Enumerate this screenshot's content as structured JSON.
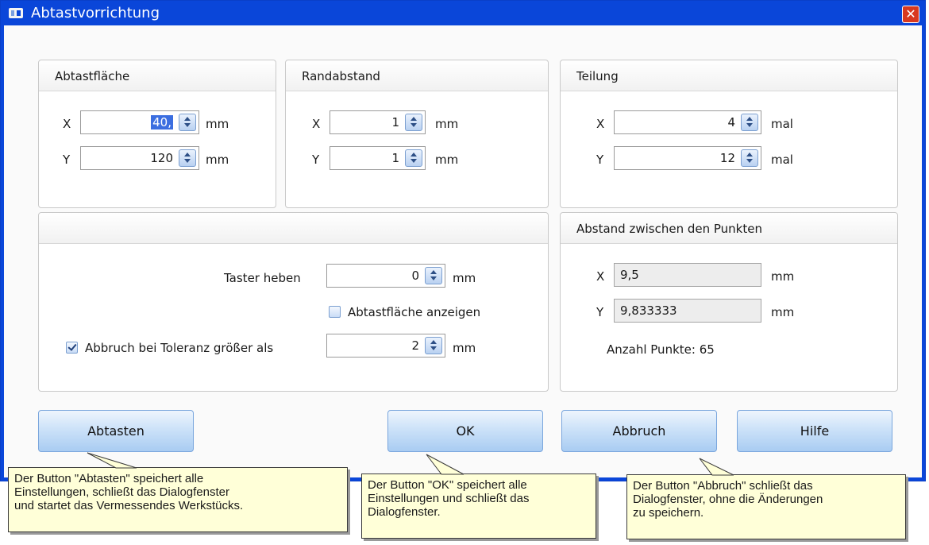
{
  "window": {
    "title": "Abtastvorrichtung",
    "close_glyph": "✕"
  },
  "groups": {
    "abtastflaeche": {
      "title": "Abtastfläche",
      "x_label": "X",
      "x_value": "40,",
      "x_unit": "mm",
      "y_label": "Y",
      "y_value": "120",
      "y_unit": "mm"
    },
    "randabstand": {
      "title": "Randabstand",
      "x_label": "X",
      "x_value": "1",
      "x_unit": "mm",
      "y_label": "Y",
      "y_value": "1",
      "y_unit": "mm"
    },
    "teilung": {
      "title": "Teilung",
      "x_label": "X",
      "x_value": "4",
      "x_unit": "mal",
      "y_label": "Y",
      "y_value": "12",
      "y_unit": "mal"
    },
    "options": {
      "taster_label": "Taster heben",
      "taster_value": "0",
      "taster_unit": "mm",
      "show_area_label": "Abtastfläche anzeigen",
      "show_area_checked": false,
      "abort_label": "Abbruch bei Toleranz größer als",
      "abort_checked": true,
      "abort_value": "2",
      "abort_unit": "mm"
    },
    "abstand": {
      "title": "Abstand zwischen den Punkten",
      "x_label": "X",
      "x_value": "9,5",
      "x_unit": "mm",
      "y_label": "Y",
      "y_value": "9,833333",
      "y_unit": "mm",
      "count_text": "Anzahl Punkte: 65"
    }
  },
  "buttons": {
    "abtasten": "Abtasten",
    "ok": "OK",
    "abbruch": "Abbruch",
    "hilfe": "Hilfe"
  },
  "callouts": {
    "abtasten": [
      "Der Button \"Abtasten\" speichert alle",
      "Einstellungen, schließt das Dialogfenster",
      "und startet das Vermessendes Werkstücks."
    ],
    "ok": [
      "Der Button \"OK\" speichert alle",
      "Einstellungen und schließt das",
      "Dialogfenster."
    ],
    "abbruch": [
      "Der Button \"Abbruch\" schließt das",
      "Dialogfenster, ohne die Änderungen",
      "zu speichern."
    ]
  },
  "colors": {
    "titlebar": "#0a46d9",
    "callout_bg": "#ffffd8",
    "selection": "#3b6ee0"
  },
  "icons": [
    "window-icon",
    "close-icon",
    "spinner-arrows-icon",
    "checkbox-check-icon"
  ]
}
